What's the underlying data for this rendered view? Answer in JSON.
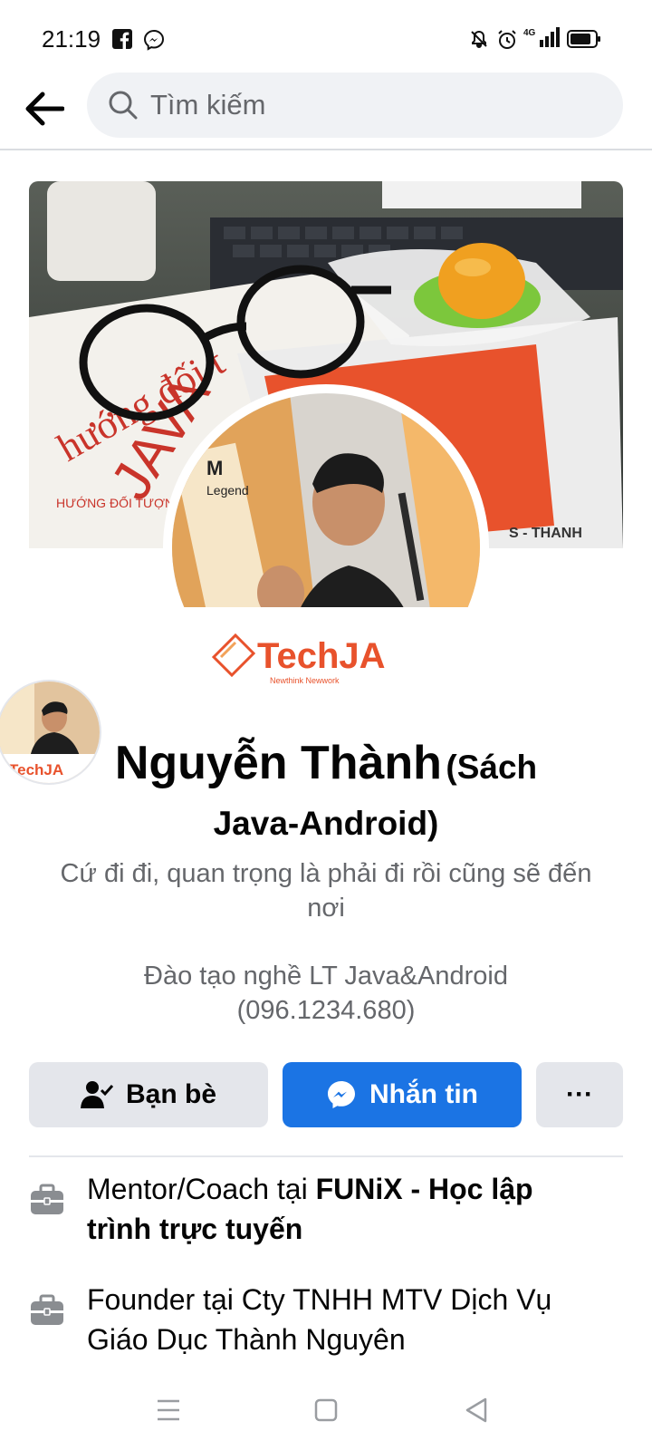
{
  "status_bar": {
    "time": "21:19",
    "left_icons": [
      "facebook-icon",
      "messenger-icon"
    ],
    "right_icons": [
      "bell-muted-icon",
      "alarm-icon",
      "signal-4g-icon",
      "battery-icon"
    ],
    "network": "4G"
  },
  "header": {
    "search_placeholder": "Tìm kiếm",
    "back_icon": "back-arrow-icon",
    "search_icon": "search-icon"
  },
  "profile": {
    "logo_text": "TechJA",
    "logo_tagline": "Newthink Newwork",
    "name": "Nguyễn Thành",
    "name_suffix_1": "(Sách",
    "name_suffix_2": "Java-Android)",
    "bio": "Cứ đi đi, quan trọng là phải đi rồi cũng sẽ đến nơi",
    "work_line_1": "Đào tạo nghề LT Java&Android",
    "work_line_2": "(096.1234.680)"
  },
  "actions": {
    "friends_label": "Bạn bè",
    "message_label": "Nhắn tin",
    "more_label": "···",
    "message_color": "#1b74e4"
  },
  "info": [
    {
      "prefix": "Mentor/Coach tại ",
      "org": "FUNiX - Học lập trình trực tuyến"
    },
    {
      "prefix": "Founder tại Cty TNHH MTV Dịch Vụ Giáo Dục Thành Nguyên",
      "org": ""
    }
  ],
  "nav": {
    "icons": [
      "menu-icon",
      "home-square-icon",
      "back-triangle-icon"
    ]
  }
}
